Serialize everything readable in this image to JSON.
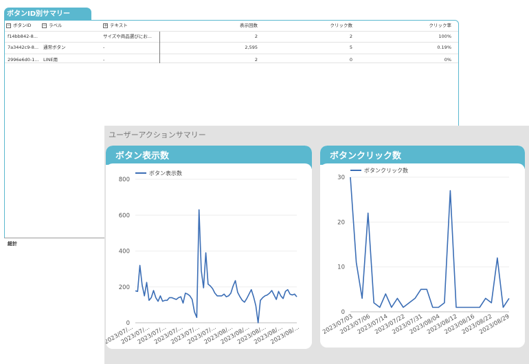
{
  "summary": {
    "title": "ボタンID別サマリー",
    "headers": {
      "button_id": "ボタンID",
      "label": "ラベル",
      "text": "テキスト",
      "views": "表示回数",
      "clicks": "クリック数",
      "ctr": "クリック率"
    },
    "rows": [
      {
        "button_id": "f14bb842-8...",
        "label": "",
        "text": "サイズや商品選びにお...",
        "views": "2",
        "clicks": "2",
        "ctr": "100%"
      },
      {
        "button_id": "7a3442c9-8...",
        "label": "通常ボタン",
        "text": "-",
        "views": "2,595",
        "clicks": "5",
        "ctr": "0.19%"
      },
      {
        "button_id": "2996e6d0-1...",
        "label": "LINE用",
        "text": "-",
        "views": "2",
        "clicks": "0",
        "ctr": "0%"
      }
    ],
    "footer": "総計"
  },
  "action_summary": {
    "title": "ユーザーアクションサマリー",
    "views_card_title": "ボタン表示数",
    "clicks_card_title": "ボタンクリック数"
  },
  "colors": {
    "accent": "#5ab8cf",
    "series": "#3a6db5",
    "overlay_bg": "#e2e2e2"
  },
  "chart_data": [
    {
      "type": "line",
      "title": "ボタン表示数",
      "series": [
        {
          "name": "ボタン表示数",
          "values": [
            178,
            175,
            320,
            210,
            150,
            225,
            125,
            140,
            180,
            140,
            120,
            150,
            120,
            125,
            125,
            140,
            140,
            135,
            130,
            140,
            145,
            110,
            165,
            160,
            150,
            130,
            60,
            30,
            630,
            290,
            195,
            390,
            215,
            205,
            190,
            165,
            150,
            150,
            150,
            160,
            145,
            150,
            165,
            205,
            235,
            170,
            145,
            125,
            115,
            135,
            160,
            185,
            145,
            95,
            0,
            125,
            140,
            150,
            155,
            165,
            180,
            155,
            130,
            175,
            150,
            135,
            175,
            185,
            160,
            155,
            160,
            145
          ]
        }
      ],
      "x_tick_labels": [
        "2023/07/...",
        "2023/07/...",
        "2023/07/...",
        "2023/07/...",
        "2023/07/...",
        "2023/07/...",
        "2023/08/...",
        "2023/08/...",
        "2023/08/...",
        "2023/08/...",
        "2023/08/..."
      ],
      "ylim": [
        0,
        800
      ],
      "y_ticks": [
        0,
        200,
        400,
        600,
        800
      ],
      "legend": "top-left"
    },
    {
      "type": "line",
      "title": "ボタンクリック数",
      "series": [
        {
          "name": "ボタンクリック数",
          "values": [
            30,
            11,
            3,
            22,
            2,
            1,
            4,
            1,
            3,
            1,
            2,
            3,
            5,
            5,
            1,
            1,
            2,
            27,
            1,
            1,
            1,
            1,
            1,
            3,
            2,
            12,
            1,
            3
          ]
        }
      ],
      "x_tick_labels": [
        "2023/07/03",
        "2023/07/06",
        "2023/07/14",
        "2023/07/22",
        "2023/07/31",
        "2023/08/04",
        "2023/08/12",
        "2023/08/16",
        "2023/08/22",
        "2023/08/29"
      ],
      "ylim": [
        0,
        30
      ],
      "y_ticks": [
        0,
        10,
        20,
        30
      ],
      "legend": "top-left"
    }
  ]
}
